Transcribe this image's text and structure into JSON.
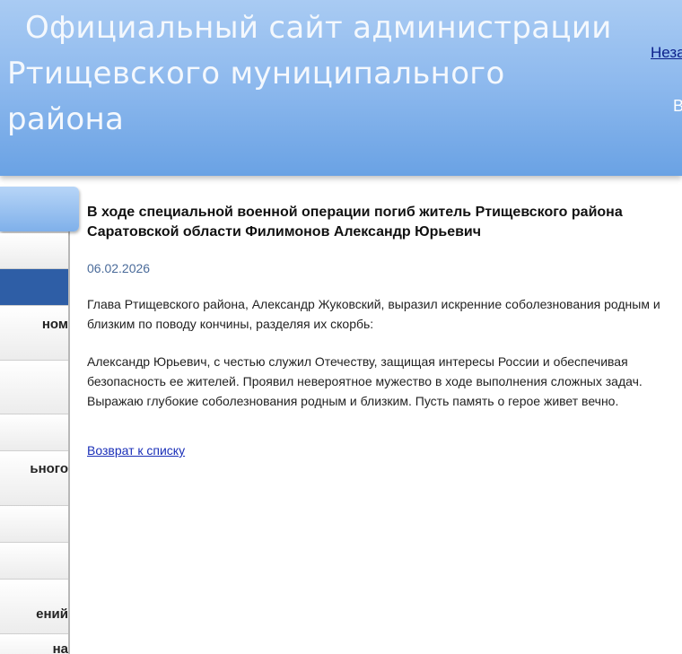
{
  "header": {
    "title_line1": "Официальный сайт администрации",
    "title_line2": "Ртищевского муниципального района",
    "link_partial": "Неза",
    "letter_partial": "В"
  },
  "sidebar": {
    "items": [
      {
        "label": ""
      },
      {
        "label": ""
      },
      {
        "label": "ном"
      },
      {
        "label": ""
      },
      {
        "label": ""
      },
      {
        "label": "ьного"
      },
      {
        "label": ""
      },
      {
        "label": ""
      },
      {
        "label": "ений"
      },
      {
        "label": "на"
      }
    ]
  },
  "article": {
    "title": "В ходе специальной военной операции погиб житель Ртищевского района Саратовской области Филимонов Александр Юрьевич",
    "date": "06.02.2026",
    "paragraph1": "Глава Ртищевского района, Александр Жуковский, выразил искренние соболезнования родным и близким по поводу кончины, разделяя их скорбь:",
    "paragraph2": "Александр Юрьевич, с честью служил Отечеству, защищая интересы России и обеспечивая безопасность ее жителей. Проявил невероятное мужество в ходе выполнения сложных задач. Выражаю глубокие соболезнования родным и близким. Пусть память о герое живет вечно.",
    "back_link": "Возврат к списку"
  },
  "colors": {
    "header_top": "#a9cbf3",
    "header_bottom": "#6aa2e4",
    "nav_active": "#2e5ea6",
    "link": "#1a2fb8",
    "date": "#4a6b9a"
  }
}
